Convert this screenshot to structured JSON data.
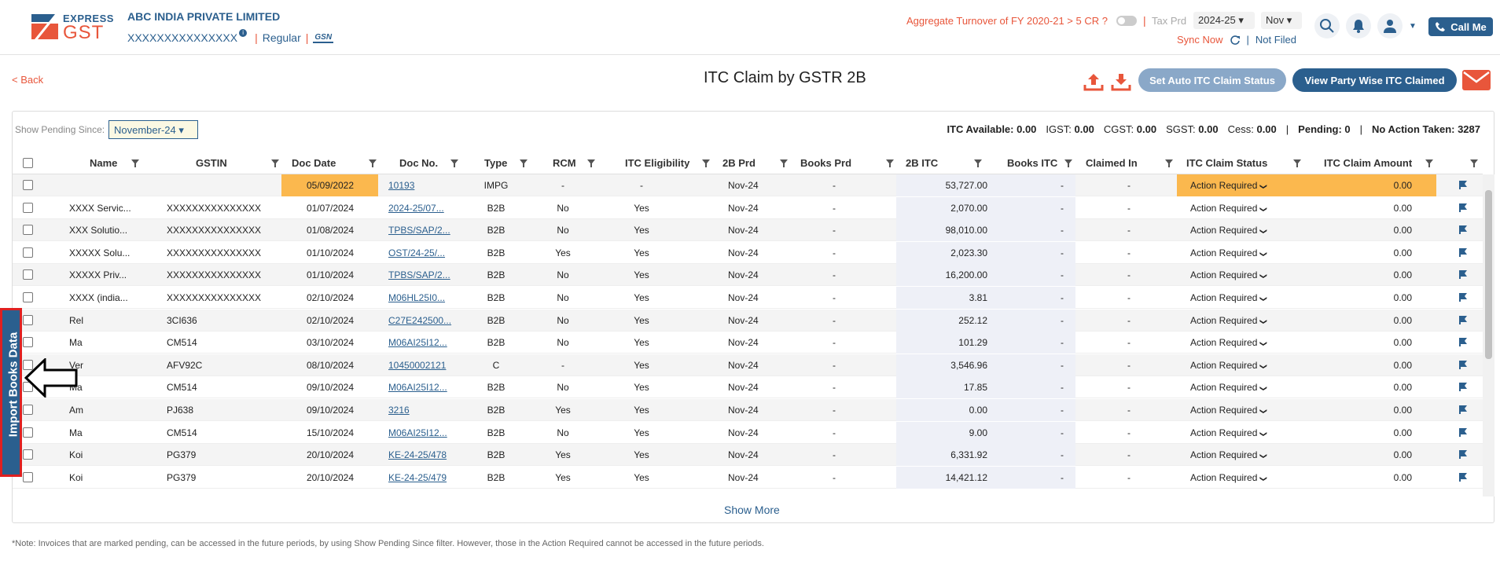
{
  "header": {
    "logo_line1": "EXPRESS",
    "logo_line2": "GST",
    "company": "ABC INDIA PRIVATE LIMITED",
    "gstin": "XXXXXXXXXXXXXXX",
    "reg_type": "Regular",
    "gsn_label": "GSN",
    "turnover_text": "Aggregate Turnover of FY 2020-21 > 5 CR ?",
    "tax_prd_label": "Tax Prd",
    "year_value": "2024-25",
    "month_value": "Nov",
    "sync_now": "Sync Now",
    "not_filed": "Not Filed",
    "call_me": "Call Me"
  },
  "page": {
    "back_label": "< Back",
    "title": "ITC Claim by GSTR 2B",
    "auto_status_btn": "Set Auto ITC Claim Status",
    "party_wise_btn": "View Party Wise ITC Claimed",
    "show_pending_label": "Show Pending Since:",
    "show_pending_value": "November-24",
    "show_more": "Show More",
    "note": "*Note: Invoices that are marked pending, can be accessed in the future periods, by using Show Pending Since filter. However, those in the Action Required cannot be accessed in the future periods.",
    "side_tab": "Import Books Data"
  },
  "summary": {
    "itc_available": "ITC Available: 0.00",
    "igst": "IGST:",
    "igst_val": "0.00",
    "cgst": "CGST:",
    "cgst_val": "0.00",
    "sgst": "SGST:",
    "sgst_val": "0.00",
    "cess": "Cess:",
    "cess_val": "0.00",
    "pending": "Pending: 0",
    "no_action": "No Action Taken: 3287"
  },
  "table": {
    "headers": [
      "Name",
      "GSTIN",
      "Doc Date",
      "Doc No.",
      "Type",
      "RCM",
      "ITC Eligibility",
      "2B Prd",
      "Books Prd",
      "2B ITC",
      "Books ITC",
      "Claimed In",
      "ITC Claim Status",
      "ITC Claim Amount"
    ],
    "rows": [
      {
        "name": "",
        "gstin": "",
        "date": "05/09/2022",
        "doc": "10193",
        "type": "IMPG",
        "rcm": "-",
        "elig": "-",
        "prd": "Nov-24",
        "books": "-",
        "itc": "53,727.00",
        "bitc": "-",
        "claimed": "-",
        "status": "Action Required",
        "amount": "0.00"
      },
      {
        "name": "XXXX Servic...",
        "gstin": "XXXXXXXXXXXXXXX",
        "date": "01/07/2024",
        "doc": "2024-25/07...",
        "type": "B2B",
        "rcm": "No",
        "elig": "Yes",
        "prd": "Nov-24",
        "books": "-",
        "itc": "2,070.00",
        "bitc": "-",
        "claimed": "-",
        "status": "Action Required",
        "amount": "0.00"
      },
      {
        "name": "XXX Solutio...",
        "gstin": "XXXXXXXXXXXXXXX",
        "date": "01/08/2024",
        "doc": "TPBS/SAP/2...",
        "type": "B2B",
        "rcm": "No",
        "elig": "Yes",
        "prd": "Nov-24",
        "books": "-",
        "itc": "98,010.00",
        "bitc": "-",
        "claimed": "-",
        "status": "Action Required",
        "amount": "0.00"
      },
      {
        "name": "XXXXX Solu...",
        "gstin": "XXXXXXXXXXXXXXX",
        "date": "01/10/2024",
        "doc": "OST/24-25/...",
        "type": "B2B",
        "rcm": "Yes",
        "elig": "Yes",
        "prd": "Nov-24",
        "books": "-",
        "itc": "2,023.30",
        "bitc": "-",
        "claimed": "-",
        "status": "Action Required",
        "amount": "0.00"
      },
      {
        "name": "XXXXX Priv...",
        "gstin": "XXXXXXXXXXXXXXX",
        "date": "01/10/2024",
        "doc": "TPBS/SAP/2...",
        "type": "B2B",
        "rcm": "No",
        "elig": "Yes",
        "prd": "Nov-24",
        "books": "-",
        "itc": "16,200.00",
        "bitc": "-",
        "claimed": "-",
        "status": "Action Required",
        "amount": "0.00"
      },
      {
        "name": "XXXX (india...",
        "gstin": "XXXXXXXXXXXXXXX",
        "date": "02/10/2024",
        "doc": "M06HL25I0...",
        "type": "B2B",
        "rcm": "No",
        "elig": "Yes",
        "prd": "Nov-24",
        "books": "-",
        "itc": "3.81",
        "bitc": "-",
        "claimed": "-",
        "status": "Action Required",
        "amount": "0.00"
      },
      {
        "name": "Rel",
        "gstin": "3CI636",
        "date": "02/10/2024",
        "doc": "C27E242500...",
        "type": "B2B",
        "rcm": "No",
        "elig": "Yes",
        "prd": "Nov-24",
        "books": "-",
        "itc": "252.12",
        "bitc": "-",
        "claimed": "-",
        "status": "Action Required",
        "amount": "0.00"
      },
      {
        "name": "Ma",
        "gstin": "CM514",
        "date": "03/10/2024",
        "doc": "M06AI25I12...",
        "type": "B2B",
        "rcm": "No",
        "elig": "Yes",
        "prd": "Nov-24",
        "books": "-",
        "itc": "101.29",
        "bitc": "-",
        "claimed": "-",
        "status": "Action Required",
        "amount": "0.00"
      },
      {
        "name": "Ver",
        "gstin": "AFV92C",
        "date": "08/10/2024",
        "doc": "10450002121",
        "type": "C",
        "rcm": "-",
        "elig": "Yes",
        "prd": "Nov-24",
        "books": "-",
        "itc": "3,546.96",
        "bitc": "-",
        "claimed": "-",
        "status": "Action Required",
        "amount": "0.00"
      },
      {
        "name": "Ma",
        "gstin": "CM514",
        "date": "09/10/2024",
        "doc": "M06AI25I12...",
        "type": "B2B",
        "rcm": "No",
        "elig": "Yes",
        "prd": "Nov-24",
        "books": "-",
        "itc": "17.85",
        "bitc": "-",
        "claimed": "-",
        "status": "Action Required",
        "amount": "0.00"
      },
      {
        "name": "Am",
        "gstin": "PJ638",
        "date": "09/10/2024",
        "doc": "3216",
        "type": "B2B",
        "rcm": "Yes",
        "elig": "Yes",
        "prd": "Nov-24",
        "books": "-",
        "itc": "0.00",
        "bitc": "-",
        "claimed": "-",
        "status": "Action Required",
        "amount": "0.00"
      },
      {
        "name": "Ma",
        "gstin": "CM514",
        "date": "15/10/2024",
        "doc": "M06AI25I12...",
        "type": "B2B",
        "rcm": "No",
        "elig": "Yes",
        "prd": "Nov-24",
        "books": "-",
        "itc": "9.00",
        "bitc": "-",
        "claimed": "-",
        "status": "Action Required",
        "amount": "0.00"
      },
      {
        "name": "Koi",
        "gstin": "PG379",
        "date": "20/10/2024",
        "doc": "KE-24-25/478",
        "type": "B2B",
        "rcm": "Yes",
        "elig": "Yes",
        "prd": "Nov-24",
        "books": "-",
        "itc": "6,331.92",
        "bitc": "-",
        "claimed": "-",
        "status": "Action Required",
        "amount": "0.00"
      },
      {
        "name": "Koi",
        "gstin": "PG379",
        "date": "20/10/2024",
        "doc": "KE-24-25/479",
        "type": "B2B",
        "rcm": "Yes",
        "elig": "Yes",
        "prd": "Nov-24",
        "books": "-",
        "itc": "14,421.12",
        "bitc": "-",
        "claimed": "-",
        "status": "Action Required",
        "amount": "0.00"
      }
    ]
  },
  "colors": {
    "brand_blue": "#2b5f8e",
    "accent_orange": "#e8563b",
    "highlight": "#fbb84e"
  }
}
